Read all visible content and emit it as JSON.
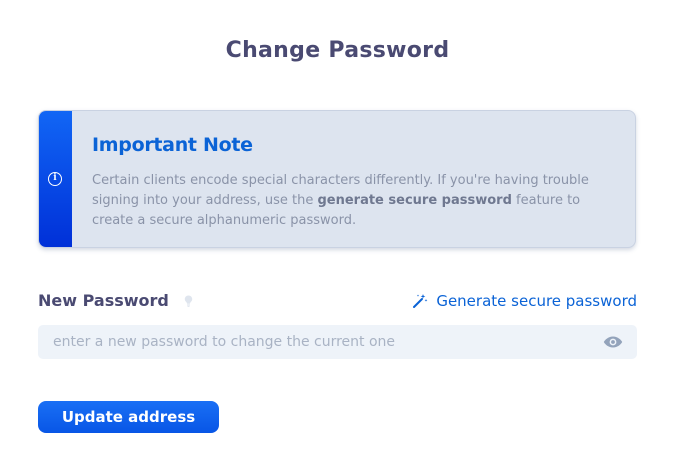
{
  "page": {
    "title": "Change Password"
  },
  "note": {
    "title": "Important Note",
    "text_before": "Certain clients encode special characters differently. If you're having trouble signing into your address, use the ",
    "text_bold": "generate secure password",
    "text_after": " feature to create a secure alphanumeric password.",
    "icon": "info-icon"
  },
  "password_field": {
    "label": "New Password",
    "hint_icon": "lightbulb-icon",
    "placeholder": "enter a new password to change the current one",
    "value": "",
    "toggle_icon": "eye-icon"
  },
  "generate_link": {
    "label": "Generate secure password",
    "icon": "magic-wand-icon"
  },
  "submit": {
    "label": "Update address"
  },
  "colors": {
    "heading": "#4a4a72",
    "accent": "#0b63d6",
    "note_bg": "#dde4ef",
    "input_bg": "#eef3f9",
    "button": "#0856e6"
  }
}
